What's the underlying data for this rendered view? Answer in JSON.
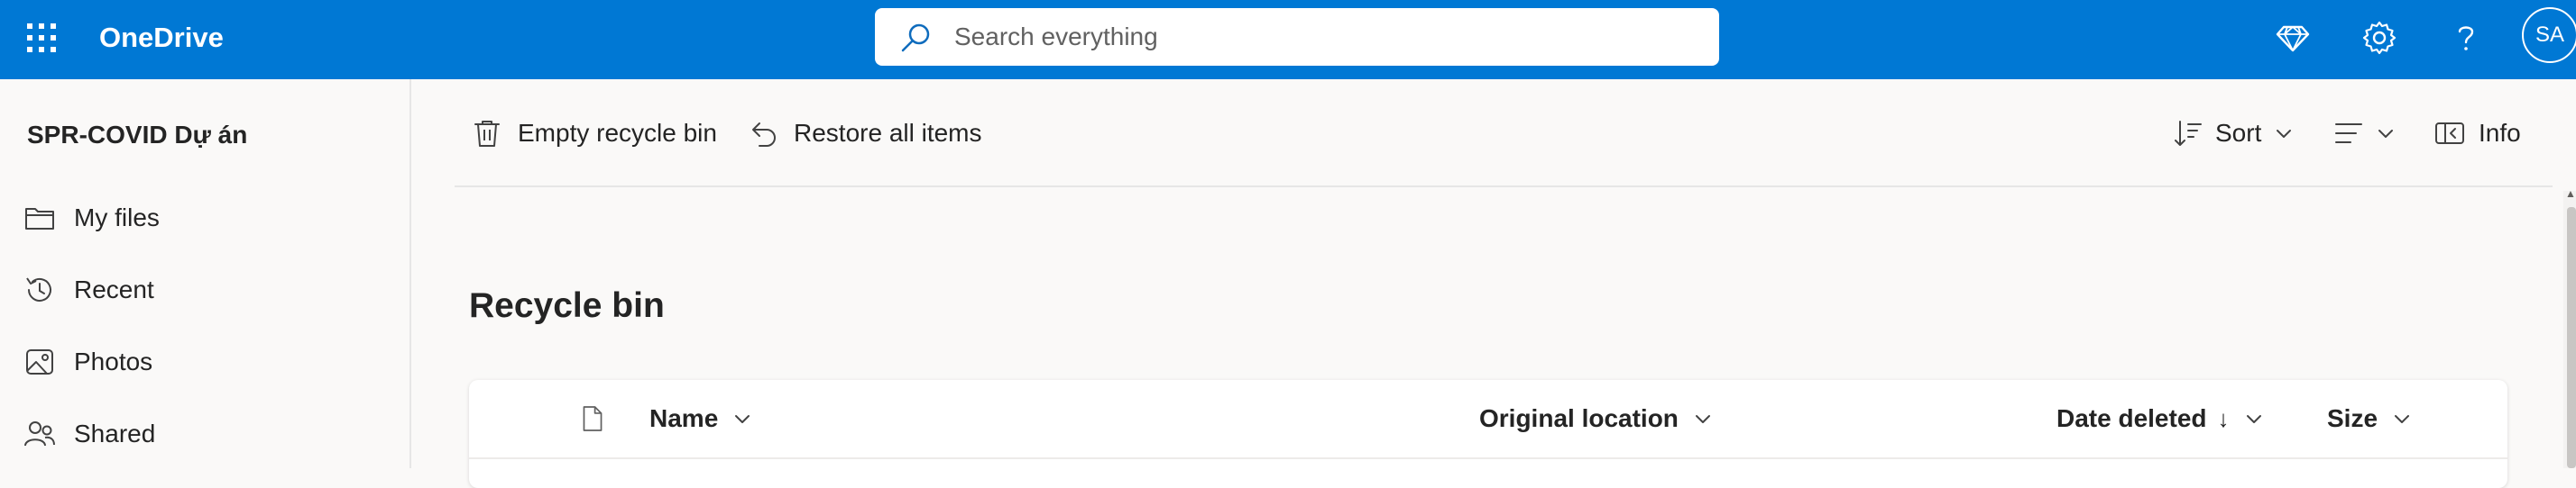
{
  "topbar": {
    "app_name": "OneDrive",
    "search_placeholder": "Search everything",
    "avatar_initials": "SA",
    "brand_color": "#0078d4",
    "icons": [
      "app-launcher-icon",
      "premium-diamond-icon",
      "settings-gear-icon",
      "help-question-icon"
    ]
  },
  "sidebar": {
    "site_title": "SPR-COVID Dự án",
    "items": [
      {
        "label": "My files",
        "icon": "folder-icon"
      },
      {
        "label": "Recent",
        "icon": "recent-clock-icon"
      },
      {
        "label": "Photos",
        "icon": "photo-icon"
      },
      {
        "label": "Shared",
        "icon": "people-icon"
      }
    ]
  },
  "commandbar": {
    "empty_label": "Empty recycle bin",
    "restore_label": "Restore all items",
    "sort_label": "Sort",
    "info_label": "Info"
  },
  "main": {
    "title": "Recycle bin",
    "columns": {
      "name": "Name",
      "original_location": "Original location",
      "date_deleted": "Date deleted",
      "date_deleted_arrow": "↓",
      "size": "Size"
    }
  }
}
